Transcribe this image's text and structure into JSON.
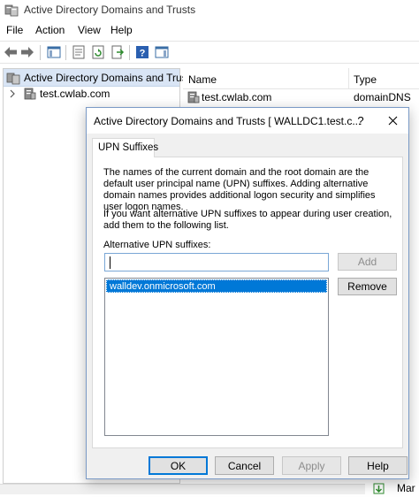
{
  "window": {
    "title": "Active Directory Domains and Trusts"
  },
  "menu": {
    "items": [
      "File",
      "Action",
      "View",
      "Help"
    ]
  },
  "toolbar": {
    "icons": [
      "back-arrow-icon",
      "forward-arrow-icon",
      "show-hide-console-tree-icon",
      "properties-icon",
      "refresh-icon",
      "export-list-icon",
      "help-icon",
      "action-pane-icon"
    ]
  },
  "tree": {
    "root_label": "Active Directory Domains and Trust",
    "items": [
      {
        "label": "test.cwlab.com",
        "icon": "domain-icon"
      }
    ]
  },
  "list": {
    "columns": [
      "Name",
      "Type"
    ],
    "rows": [
      {
        "name": "test.cwlab.com",
        "type": "domainDNS"
      }
    ]
  },
  "dialog": {
    "title": "Active Directory Domains and Trusts [ WALLDC1.test.c...",
    "help_glyph": "?",
    "tab_label": "UPN Suffixes",
    "para1": "The names of the current domain and the root domain are the default user principal name (UPN) suffixes. Adding alternative domain names provides additional logon security and simplifies user logon names.",
    "para2": "If you want alternative UPN suffixes to appear during user creation, add them to the following list.",
    "alt_label": "Alternative UPN suffixes:",
    "input_value": "",
    "add_label": "Add",
    "remove_label": "Remove",
    "suffixes": [
      "walldev.onmicrosoft.com"
    ],
    "ok_label": "OK",
    "cancel_label": "Cancel",
    "apply_label": "Apply",
    "help_label": "Help"
  },
  "taskbar": {
    "text": "Mar"
  },
  "colors": {
    "accent": "#0078d7",
    "tree_header": "#d9e5f5",
    "dialog_bg": "#f0f0f0"
  }
}
